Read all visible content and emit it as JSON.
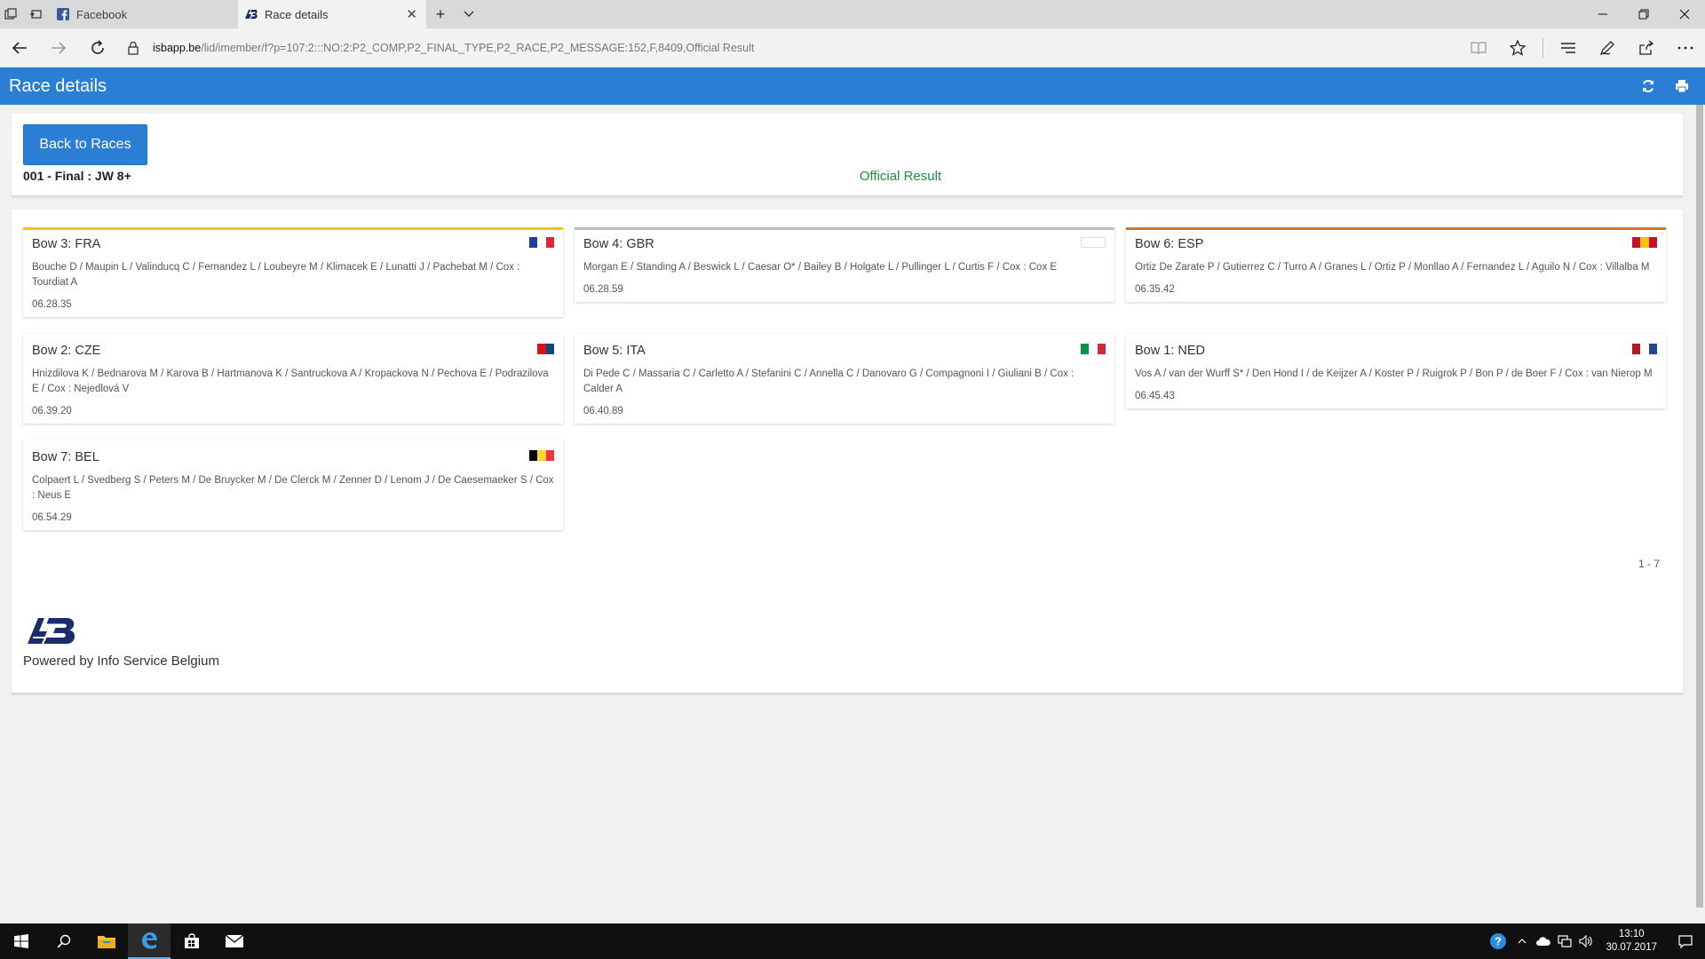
{
  "browser": {
    "tabs": [
      {
        "title": "Facebook",
        "active": false
      },
      {
        "title": "Race details",
        "active": true
      }
    ],
    "url_host": "isbapp.be",
    "url_path": "/lid/imember/f?p=107:2:::NO:2:P2_COMP,P2_FINAL_TYPE,P2_RACE,P2_MESSAGE:152,F,8409,Official Result"
  },
  "page": {
    "title": "Race details",
    "back_label": "Back to Races",
    "race_name": "001 - Final : JW 8+",
    "race_status": "Official Result",
    "pager": "1 - 7",
    "powered_by": "Powered by Info Service Belgium"
  },
  "results": [
    {
      "title": "Bow 3: FRA",
      "crew": "Bouche D / Maupin L / Valinducq C / Fernandez L / Loubeyre M / Klimacek E / Lunatti J / Pachebat M / Cox : Tourdiat A",
      "time": "06.28.35",
      "medal_color": "#f2c11a",
      "flag": [
        "#1f3f9a",
        "#ffffff",
        "#e0243a"
      ]
    },
    {
      "title": "Bow 4: GBR",
      "crew": "Morgan E / Standing A / Beswick L / Caesar O* / Bailey B / Holgate L / Pullinger L / Curtis F / Cox : Cox E",
      "time": "06.28.59",
      "medal_color": "#bdbdbd",
      "flag": [
        "#ffffff",
        "#ffffff",
        "#ffffff"
      ]
    },
    {
      "title": "Bow 6: ESP",
      "crew": "Ortiz De Zarate P / Gutierrez C / Turro A / Granes L / Ortiz P / Monllao A / Fernandez L / Aguilo N / Cox : Villalba M",
      "time": "06.35.42",
      "medal_color": "#d4762a",
      "flag": [
        "#c8102e",
        "#ffc400",
        "#c8102e"
      ]
    },
    {
      "title": "Bow 2: CZE",
      "crew": "Hnizdilova K / Bednarova M / Karova B / Hartmanova K / Santruckova A / Kropackova N / Pechova E / Podrazilova E / Cox : Nejedlová V",
      "time": "06.39.20",
      "medal_color": "",
      "flag": [
        "#ffffff",
        "#d7141a",
        "#11457e"
      ]
    },
    {
      "title": "Bow 5: ITA",
      "crew": "Di Pede C / Massaria C / Carletto A / Stefanini C / Annella C / Danovaro G / Compagnoni I / Giuliani B / Cox : Calder A",
      "time": "06.40.89",
      "medal_color": "",
      "flag": [
        "#009246",
        "#ffffff",
        "#ce2b37"
      ]
    },
    {
      "title": "Bow 1: NED",
      "crew": "Vos A / van der Wurff S* / Den Hond I / de Keijzer A / Koster P / Ruigrok P / Bon P / de Boer F / Cox : van Nierop M",
      "time": "06.45.43",
      "medal_color": "",
      "flag": [
        "#ae1c28",
        "#ffffff",
        "#21468b"
      ]
    },
    {
      "title": "Bow 7: BEL",
      "crew": "Colpaert L / Svedberg S / Peters M / De Bruycker M / De Clerck M / Zenner D / Lenom J / De Caesemaeker S / Cox : Neus E",
      "time": "06.54.29",
      "medal_color": "",
      "flag": [
        "#000000",
        "#fdda24",
        "#ef3340"
      ]
    }
  ],
  "taskbar": {
    "time": "13:10",
    "date": "30.07.2017"
  },
  "colors": {
    "header_blue": "#2a7fd4",
    "status_green": "#1e8e3e"
  }
}
